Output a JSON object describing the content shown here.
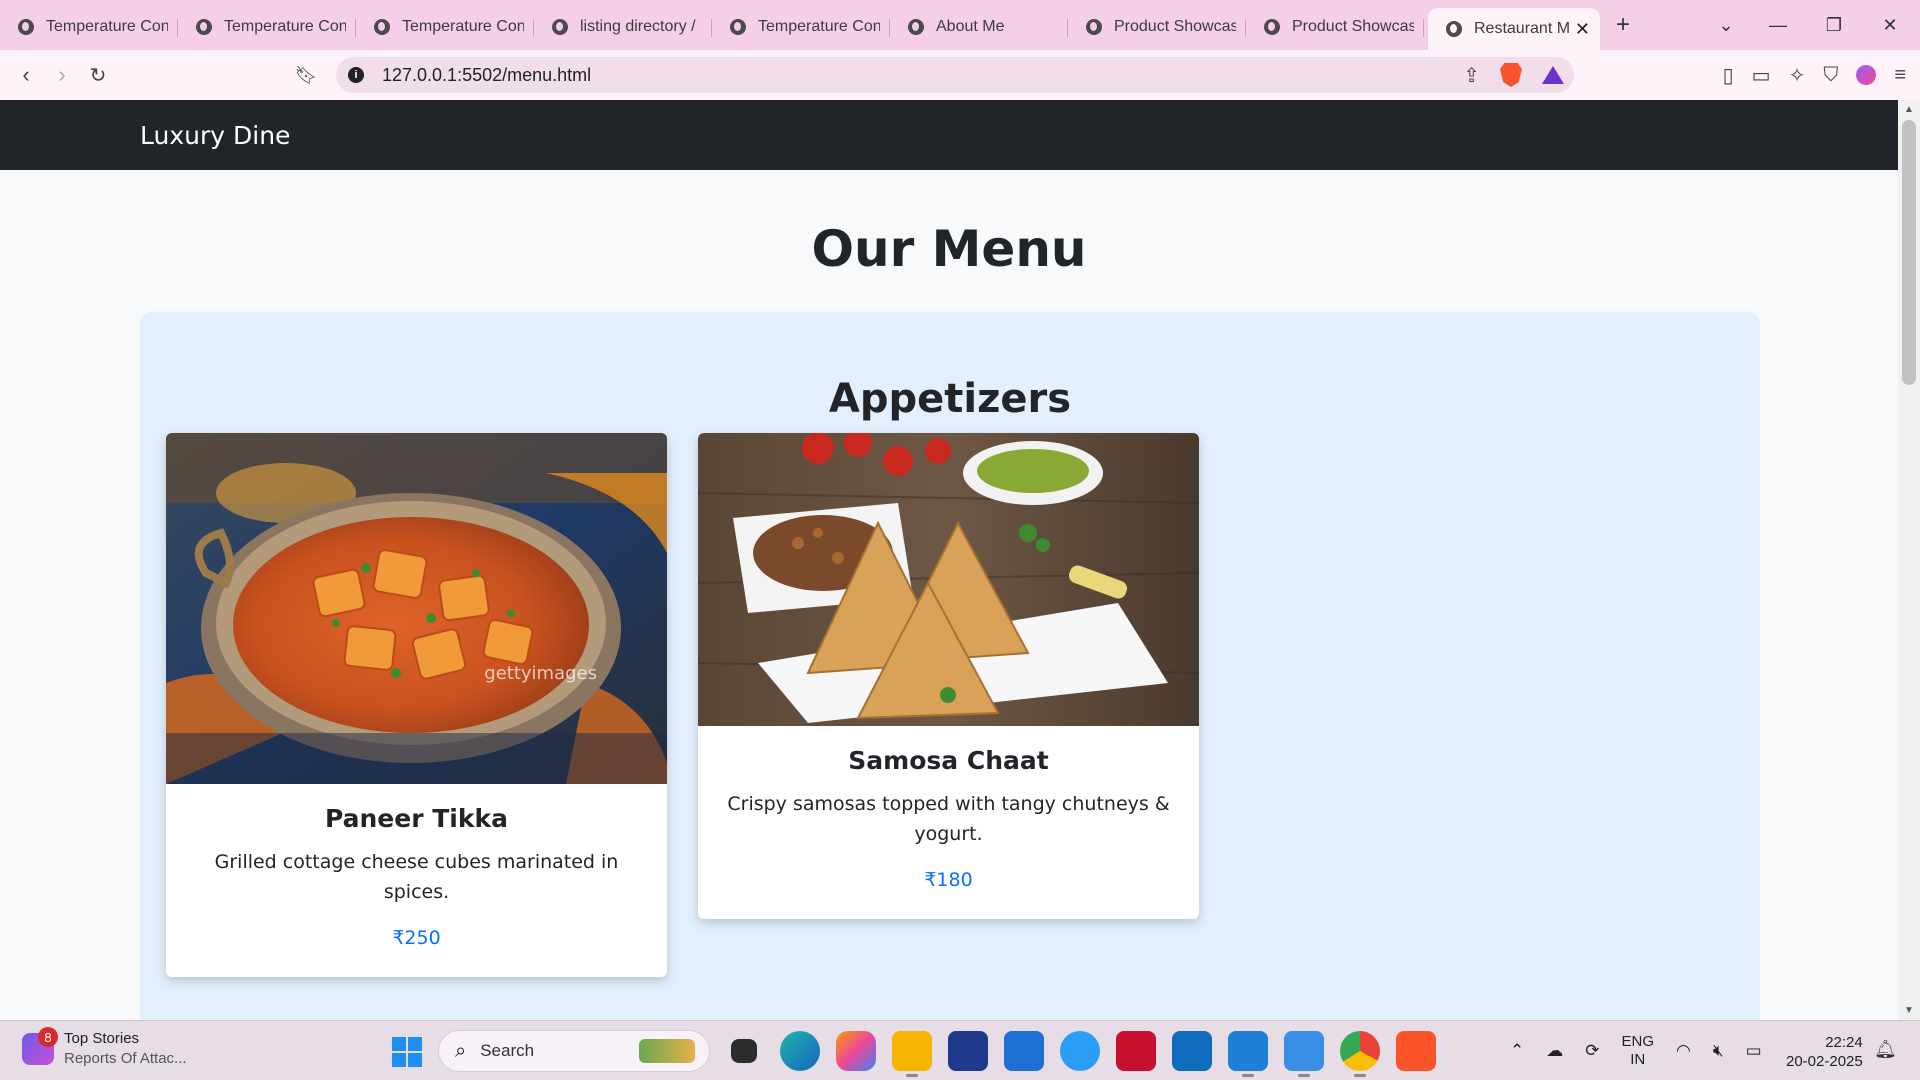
{
  "browser": {
    "tabs": [
      {
        "title": "Temperature Con",
        "active": false
      },
      {
        "title": "Temperature Con",
        "active": false
      },
      {
        "title": "Temperature Con",
        "active": false
      },
      {
        "title": "listing directory /",
        "active": false
      },
      {
        "title": "Temperature Con",
        "active": false
      },
      {
        "title": "About Me",
        "active": false
      },
      {
        "title": "Product Showcas",
        "active": false
      },
      {
        "title": "Product Showcas",
        "active": false
      },
      {
        "title": "Restaurant M",
        "active": true
      }
    ],
    "new_tab_label": "+",
    "url": "127.0.0.1:5502/menu.html"
  },
  "site": {
    "brand": "Luxury Dine",
    "page_title": "Our Menu",
    "sections": [
      {
        "title": "Appetizers",
        "items": [
          {
            "name": "Paneer Tikka",
            "description": "Grilled cottage cheese cubes marinated in spices.",
            "price": "₹250",
            "image_watermark": "gettyimages"
          },
          {
            "name": "Samosa Chaat",
            "description": "Crispy samosas topped with tangy chutneys & yogurt.",
            "price": "₹180"
          }
        ]
      }
    ]
  },
  "taskbar": {
    "news_badge": "8",
    "news_title": "Top Stories",
    "news_subtitle": "Reports Of Attac...",
    "search_label": "Search",
    "lang_top": "ENG",
    "lang_bottom": "IN",
    "time": "22:24",
    "date": "20-02-2025"
  },
  "colors": {
    "tab_strip": "#f4cfe6",
    "navbar": "#212529",
    "section_bg": "#e2effc",
    "price": "#0d6efd"
  }
}
